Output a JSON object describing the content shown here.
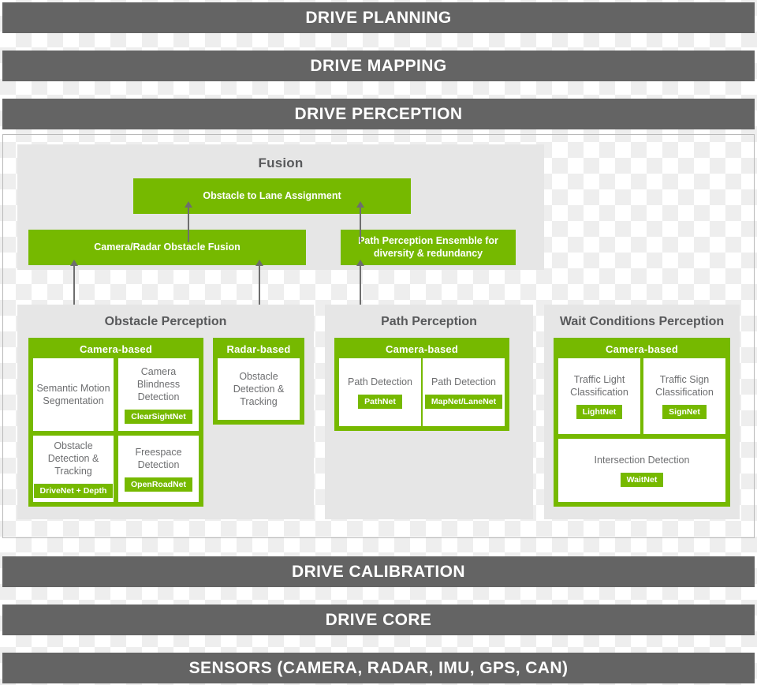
{
  "stack_bars": [
    {
      "id": "drive-planning",
      "label": "DRIVE PLANNING"
    },
    {
      "id": "drive-mapping",
      "label": "DRIVE MAPPING"
    },
    {
      "id": "drive-perception",
      "label": "DRIVE PERCEPTION"
    },
    {
      "id": "drive-calibration",
      "label": "DRIVE CALIBRATION"
    },
    {
      "id": "drive-core",
      "label": "DRIVE CORE"
    },
    {
      "id": "sensors",
      "label": "SENSORS (CAMERA, RADAR, IMU, GPS, CAN)"
    }
  ],
  "colors": {
    "bar_gray": "#646464",
    "nvidia_green": "#76b900",
    "panel_gray": "#e6e6e6",
    "text_gray": "#58595b",
    "leaf_text_gray": "#6d6e70",
    "arrow_gray": "#6e6e6e"
  },
  "fusion": {
    "title": "Fusion",
    "boxes": {
      "obstacle_to_lane": "Obstacle to Lane Assignment",
      "camera_radar_fusion": "Camera/Radar Obstacle Fusion",
      "path_ensemble": "Path Perception Ensemble for diversity & redundancy"
    }
  },
  "groups": {
    "obstacle": {
      "title": "Obstacle Perception",
      "camera": {
        "title": "Camera-based",
        "leaves": [
          {
            "label": "Semantic Motion Segmentation",
            "tag": ""
          },
          {
            "label": "Camera Blindness Detection",
            "tag": "ClearSightNet"
          },
          {
            "label": "Obstacle Detection & Tracking",
            "tag": "DriveNet + Depth"
          },
          {
            "label": "Freespace Detection",
            "tag": "OpenRoadNet"
          }
        ]
      },
      "radar": {
        "title": "Radar-based",
        "leaves": [
          {
            "label": "Obstacle Detection & Tracking",
            "tag": ""
          }
        ]
      }
    },
    "path": {
      "title": "Path Perception",
      "camera": {
        "title": "Camera-based",
        "leaves": [
          {
            "label": "Path Detection",
            "tag": "PathNet"
          },
          {
            "label": "Path Detection",
            "tag": "MapNet/LaneNet"
          }
        ]
      }
    },
    "wait": {
      "title": "Wait Conditions Perception",
      "camera": {
        "title": "Camera-based",
        "leaves": [
          {
            "label": "Traffic Light Classification",
            "tag": "LightNet"
          },
          {
            "label": "Traffic Sign Classification",
            "tag": "SignNet"
          },
          {
            "label": "Intersection Detection",
            "tag": "WaitNet"
          }
        ]
      }
    }
  }
}
